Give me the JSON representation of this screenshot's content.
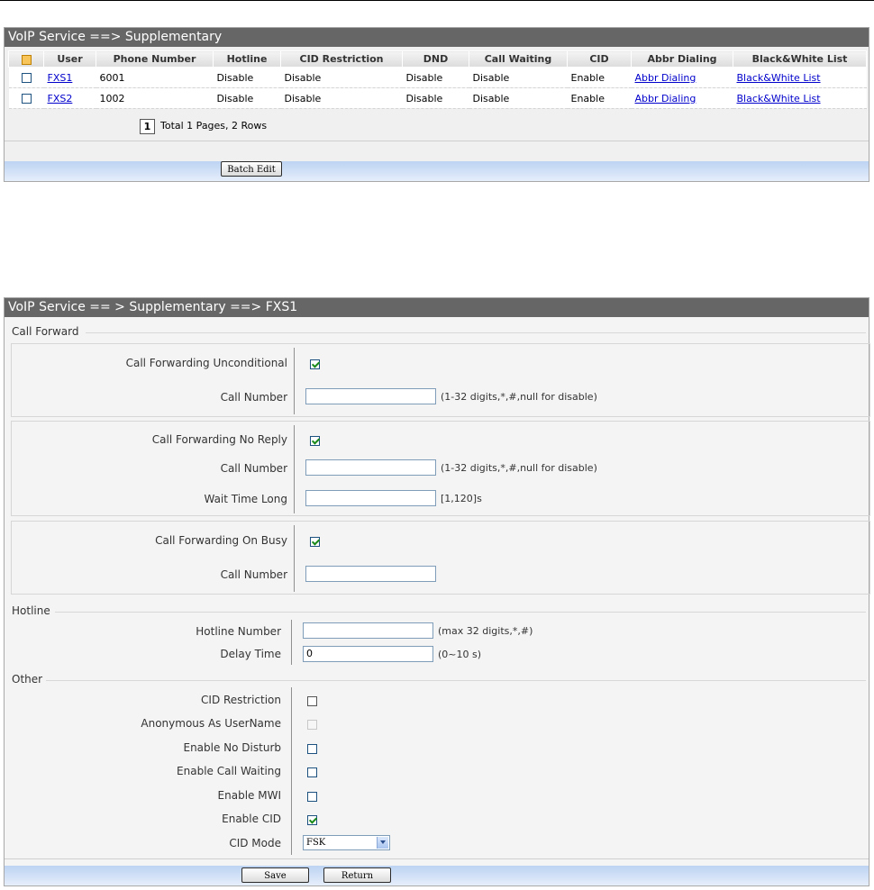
{
  "list_panel": {
    "title": "VoIP Service ==> Supplementary",
    "columns": [
      "User",
      "Phone Number",
      "Hotline",
      "CID Restriction",
      "DND",
      "Call Waiting",
      "CID",
      "Abbr Dialing",
      "Black&White List"
    ],
    "rows": [
      {
        "user": "FXS1",
        "phone": "6001",
        "hotline": "Disable",
        "cid_restriction": "Disable",
        "dnd": "Disable",
        "call_waiting": "Disable",
        "cid": "Enable",
        "abbr": "Abbr Dialing",
        "bwlist": "Black&White List"
      },
      {
        "user": "FXS2",
        "phone": "1002",
        "hotline": "Disable",
        "cid_restriction": "Disable",
        "dnd": "Disable",
        "call_waiting": "Disable",
        "cid": "Enable",
        "abbr": "Abbr Dialing",
        "bwlist": "Black&White List"
      }
    ],
    "pager": {
      "page": "1",
      "summary": "Total 1 Pages, 2 Rows"
    },
    "batch_edit_label": "Batch Edit"
  },
  "detail_panel": {
    "title": "VoIP Service == > Supplementary ==> FXS1",
    "call_forward": {
      "section": "Call Forward",
      "unconditional_label": "Call Forwarding Unconditional",
      "unconditional_number_label": "Call Number",
      "unconditional_number_value": "",
      "unconditional_number_hint": "(1-32 digits,*,#,null for disable)",
      "no_reply_label": "Call Forwarding No Reply",
      "no_reply_number_label": "Call Number",
      "no_reply_number_value": "",
      "no_reply_number_hint": "(1-32 digits,*,#,null for disable)",
      "wait_time_label": "Wait Time Long",
      "wait_time_value": "",
      "wait_time_hint": "[1,120]s",
      "on_busy_label": "Call Forwarding On Busy",
      "on_busy_number_label": "Call Number",
      "on_busy_number_value": ""
    },
    "hotline": {
      "section": "Hotline",
      "number_label": "Hotline Number",
      "number_value": "",
      "number_hint": "(max 32 digits,*,#)",
      "delay_label": "Delay Time",
      "delay_value": "0",
      "delay_hint": "(0~10 s)"
    },
    "other": {
      "section": "Other",
      "cid_restriction_label": "CID Restriction",
      "anonymous_label": "Anonymous As UserName",
      "no_disturb_label": "Enable No Disturb",
      "call_waiting_label": "Enable Call Waiting",
      "mwi_label": "Enable MWI",
      "cid_label": "Enable CID",
      "cid_mode_label": "CID Mode",
      "cid_mode_value": "FSK"
    },
    "save_label": "Save",
    "return_label": "Return"
  },
  "colors": {
    "titlebar": "#666666",
    "link": "#0000cc",
    "footer_bar": "#bcd3f2"
  }
}
